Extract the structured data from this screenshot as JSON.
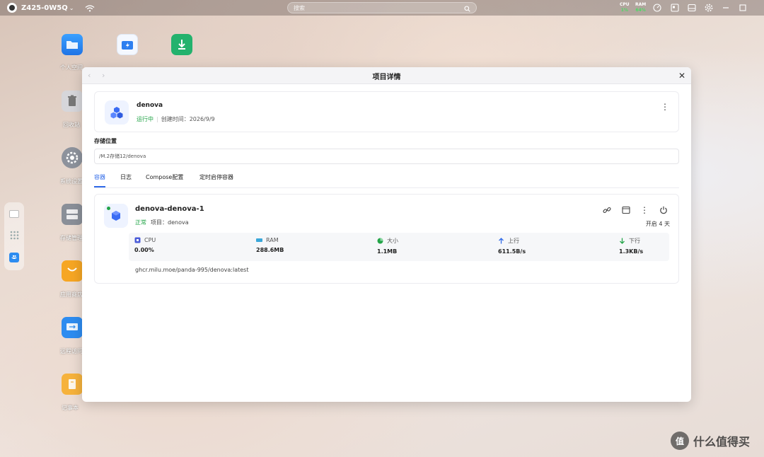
{
  "topbar": {
    "device_name": "Z425-0W5Q",
    "search_placeholder": "搜索",
    "cpu": {
      "label": "CPU",
      "value": "1%"
    },
    "ram": {
      "label": "RAM",
      "value": "64%"
    }
  },
  "desktop": {
    "icons": [
      {
        "label": "个人空间",
        "icon": "folder-icon",
        "color": "#2d8cf0"
      },
      {
        "label": "回收站",
        "icon": "trash-icon",
        "color": "#8a8a8f"
      },
      {
        "label": "系统设置",
        "icon": "gear-icon",
        "color": "#6b6f78"
      },
      {
        "label": "存储管理",
        "icon": "storage-icon",
        "color": "#7a7f88"
      },
      {
        "label": "应用商店",
        "icon": "store-icon",
        "color": "#f6a623"
      },
      {
        "label": "远程访问",
        "icon": "remote-icon",
        "color": "#2d8cf0"
      },
      {
        "label": "记事本",
        "icon": "note-icon",
        "color": "#f6b23c"
      }
    ]
  },
  "modal": {
    "title": "项目详情",
    "project": {
      "name": "denova",
      "status": "运行中",
      "created": "创建时间：2026/9/9"
    },
    "storage_label": "存储位置",
    "storage_path": "/M.2存储12/denova",
    "tabs": [
      "容器",
      "日志",
      "Compose配置",
      "定时启停容器"
    ],
    "container": {
      "name": "denova-denova-1",
      "status": "正常",
      "project_label": "项目：denova",
      "uptime": "开启 4 天",
      "stats": [
        {
          "label": "CPU",
          "value": "0.00%",
          "icon": "cpu-icon",
          "color": "#4a5bd8"
        },
        {
          "label": "RAM",
          "value": "288.6MB",
          "icon": "ram-icon",
          "color": "#3aa7d9"
        },
        {
          "label": "大小",
          "value": "1.1MB",
          "icon": "pie-icon",
          "color": "#22a447"
        },
        {
          "label": "上行",
          "value": "611.5B/s",
          "icon": "arrow-up-icon",
          "color": "#2f6ae8"
        },
        {
          "label": "下行",
          "value": "1.3KB/s",
          "icon": "arrow-down-icon",
          "color": "#22a447"
        }
      ],
      "image": "ghcr.milu.moe/panda-995/denova:latest"
    }
  },
  "watermark": {
    "text": "什么值得买",
    "mark": "值"
  }
}
